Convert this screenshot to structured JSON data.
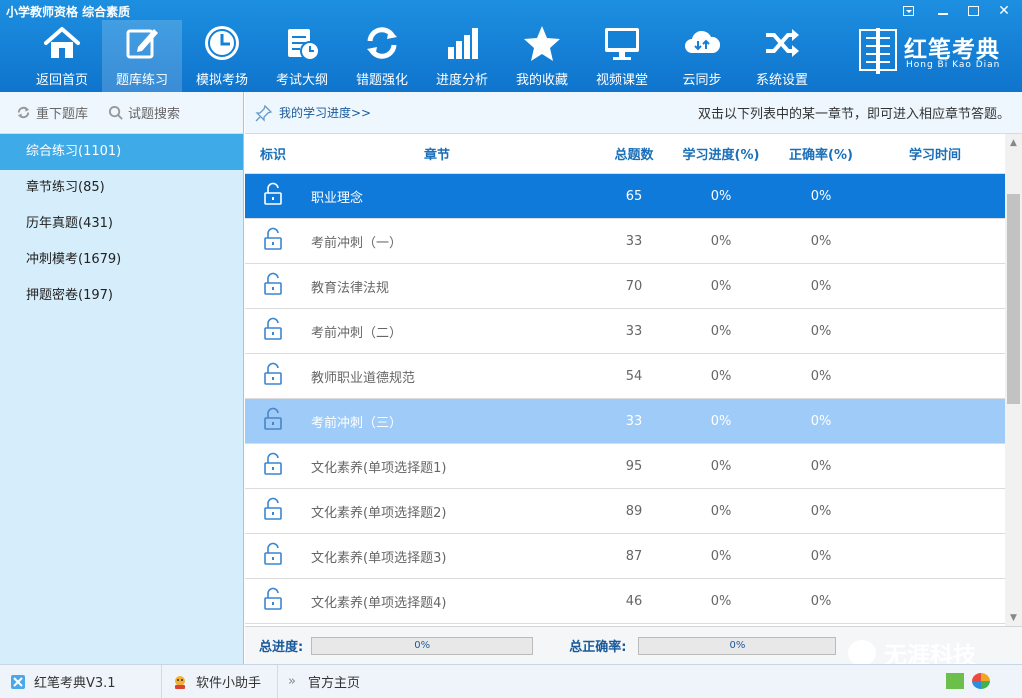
{
  "window": {
    "title": "小学教师资格 综合素质"
  },
  "toolbar": {
    "items": [
      {
        "label": "返回首页",
        "icon": "home-icon"
      },
      {
        "label": "题库练习",
        "icon": "edit-icon",
        "active": true
      },
      {
        "label": "模拟考场",
        "icon": "clock-icon"
      },
      {
        "label": "考试大纲",
        "icon": "syllabus-icon"
      },
      {
        "label": "错题强化",
        "icon": "refresh-icon"
      },
      {
        "label": "进度分析",
        "icon": "chart-icon"
      },
      {
        "label": "我的收藏",
        "icon": "star-icon"
      },
      {
        "label": "视频课堂",
        "icon": "monitor-icon"
      },
      {
        "label": "云同步",
        "icon": "cloud-icon"
      },
      {
        "label": "系统设置",
        "icon": "shuffle-icon"
      }
    ]
  },
  "brand": {
    "name": "红笔考典",
    "pinyin": "Hong Bi Kao Dian"
  },
  "sidebar": {
    "tools": [
      {
        "label": "重下题库",
        "icon": "reload-icon"
      },
      {
        "label": "试题搜索",
        "icon": "search-icon"
      }
    ],
    "items": [
      {
        "label": "综合练习(1101)",
        "active": true
      },
      {
        "label": "章节练习(85)"
      },
      {
        "label": "历年真题(431)"
      },
      {
        "label": "冲刺模考(1679)"
      },
      {
        "label": "押题密卷(197)"
      }
    ]
  },
  "content": {
    "header_title": "我的学习进度>>",
    "header_hint": "双击以下列表中的某一章节，即可进入相应章节答题。",
    "columns": {
      "mark": "标识",
      "chapter": "章节",
      "total": "总题数",
      "progress": "学习进度(%)",
      "rate": "正确率(%)",
      "time": "学习时间"
    },
    "rows": [
      {
        "chapter": "职业理念",
        "total": "65",
        "progress": "0%",
        "rate": "0%",
        "time": ""
      },
      {
        "chapter": "考前冲刺（一）",
        "total": "33",
        "progress": "0%",
        "rate": "0%",
        "time": ""
      },
      {
        "chapter": "教育法律法规",
        "total": "70",
        "progress": "0%",
        "rate": "0%",
        "time": ""
      },
      {
        "chapter": "考前冲刺（二）",
        "total": "33",
        "progress": "0%",
        "rate": "0%",
        "time": ""
      },
      {
        "chapter": "教师职业道德规范",
        "total": "54",
        "progress": "0%",
        "rate": "0%",
        "time": ""
      },
      {
        "chapter": "考前冲刺（三）",
        "total": "33",
        "progress": "0%",
        "rate": "0%",
        "time": ""
      },
      {
        "chapter": "文化素养(单项选择题1)",
        "total": "95",
        "progress": "0%",
        "rate": "0%",
        "time": ""
      },
      {
        "chapter": "文化素养(单项选择题2)",
        "total": "89",
        "progress": "0%",
        "rate": "0%",
        "time": ""
      },
      {
        "chapter": "文化素养(单项选择题3)",
        "total": "87",
        "progress": "0%",
        "rate": "0%",
        "time": ""
      },
      {
        "chapter": "文化素养(单项选择题4)",
        "total": "46",
        "progress": "0%",
        "rate": "0%",
        "time": ""
      }
    ],
    "footer": {
      "total_progress_label": "总进度:",
      "total_progress_value": "0%",
      "total_rate_label": "总正确率:",
      "total_rate_value": "0%"
    }
  },
  "watermark": {
    "text": "无涯科技"
  },
  "statusbar": {
    "version": "红笔考典V3.1",
    "helper": "软件小助手",
    "homepage": "官方主页"
  },
  "colors": {
    "topbar": "#1a87d9",
    "selected_row": "#0f7ad9",
    "hover_row": "#9ecbf7",
    "sidebar_active": "#3eaae8"
  }
}
